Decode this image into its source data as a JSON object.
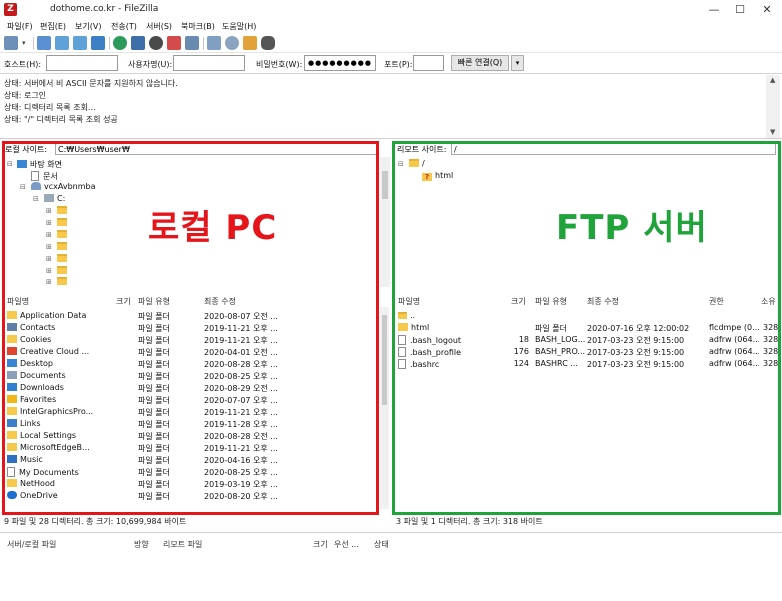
{
  "window": {
    "title": "dothome.co.kr - FileZilla",
    "app_icon_glyph": "Z",
    "minimize": "—",
    "maximize": "☐",
    "close": "✕"
  },
  "menu": [
    "파일(F)",
    "편집(E)",
    "보기(V)",
    "전송(T)",
    "서버(S)",
    "북마크(B)",
    "도움말(H)"
  ],
  "quickconnect": {
    "host_label": "호스트(H):",
    "host_value": "",
    "user_label": "사용자명(U):",
    "user_value": "",
    "pass_label": "비밀번호(W):",
    "pass_value": "●●●●●●●●●",
    "port_label": "포트(P):",
    "port_value": "",
    "connect_button": "빠른 연결(Q)",
    "dropdown_glyph": "▾"
  },
  "log": [
    "상태:  서버에서 비 ASCII 문자를 지원하지 않습니다.",
    "상태:  로그인",
    "상태:  디렉터리 목록 조회...",
    "상태:  \"/\" 디렉터리 목록 조회 성공"
  ],
  "local": {
    "site_label": "로컬 사이트:",
    "path": "C:₩Users₩user₩",
    "tree": {
      "desktop": "바탕 화면",
      "documents": "문서",
      "user": "vcxAvbnmba",
      "drive": "C:"
    },
    "columns": [
      "파일명",
      "크기",
      "파일 유형",
      "최종 수정"
    ],
    "files": [
      {
        "name": "Application Data",
        "type": "파일 폴더",
        "modified": "2020-08-07 오전 ..."
      },
      {
        "name": "Contacts",
        "type": "파일 폴더",
        "modified": "2019-11-21 오후 ..."
      },
      {
        "name": "Cookies",
        "type": "파일 폴더",
        "modified": "2019-11-21 오후 ..."
      },
      {
        "name": "Creative Cloud ...",
        "type": "파일 폴더",
        "modified": "2020-04-01 오전 ..."
      },
      {
        "name": "Desktop",
        "type": "파일 폴더",
        "modified": "2020-08-28 오후 ..."
      },
      {
        "name": "Documents",
        "type": "파일 폴더",
        "modified": "2020-08-25 오후 ..."
      },
      {
        "name": "Downloads",
        "type": "파일 폴더",
        "modified": "2020-08-29 오전 ..."
      },
      {
        "name": "Favorites",
        "type": "파일 폴더",
        "modified": "2020-07-07 오후 ..."
      },
      {
        "name": "IntelGraphicsPro...",
        "type": "파일 폴더",
        "modified": "2019-11-21 오후 ..."
      },
      {
        "name": "Links",
        "type": "파일 폴더",
        "modified": "2019-11-28 오후 ..."
      },
      {
        "name": "Local Settings",
        "type": "파일 폴더",
        "modified": "2020-08-28 오전 ..."
      },
      {
        "name": "MicrosoftEdgeB...",
        "type": "파일 폴더",
        "modified": "2019-11-21 오후 ..."
      },
      {
        "name": "Music",
        "type": "파일 폴더",
        "modified": "2020-04-16 오후 ..."
      },
      {
        "name": "My Documents",
        "type": "파일 폴더",
        "modified": "2020-08-25 오후 ..."
      },
      {
        "name": "NetHood",
        "type": "파일 폴더",
        "modified": "2019-03-19 오후 ..."
      },
      {
        "name": "OneDrive",
        "type": "파일 폴더",
        "modified": "2020-08-20 오후 ..."
      }
    ],
    "status": "9 파일 및 28 디렉터리. 총 크기: 10,699,984 바이트",
    "overlay_label": "로컬 PC",
    "overlay_color": "#e5161b"
  },
  "remote": {
    "site_label": "리모트 사이트:",
    "path": "/",
    "tree": {
      "root": "/",
      "child": "html",
      "unknown_glyph": "?"
    },
    "columns": [
      "파일명",
      "크기",
      "파일 유형",
      "최종 수정",
      "권한",
      "소유"
    ],
    "parent_entry": "..",
    "files": [
      {
        "name": "html",
        "size": "",
        "type": "파일 폴더",
        "modified": "2020-07-16 오후 12:00:02",
        "perm": "flcdmpe (0...",
        "owner": "328"
      },
      {
        "name": ".bash_logout",
        "size": "18",
        "type": "BASH_LOG...",
        "modified": "2017-03-23 오전 9:15:00",
        "perm": "adfrw (064...",
        "owner": "328"
      },
      {
        "name": ".bash_profile",
        "size": "176",
        "type": "BASH_PRO...",
        "modified": "2017-03-23 오전 9:15:00",
        "perm": "adfrw (064...",
        "owner": "328"
      },
      {
        "name": ".bashrc",
        "size": "124",
        "type": "BASHRC ...",
        "modified": "2017-03-23 오전 9:15:00",
        "perm": "adfrw (064...",
        "owner": "328"
      }
    ],
    "status": "3 파일 및 1 디렉터리. 총 크기: 318 바이트",
    "overlay_label": "FTP 서버",
    "overlay_color": "#1fa33a"
  },
  "queue": {
    "columns": [
      "서버/로컬 파일",
      "방향",
      "리모트 파일",
      "크기",
      "우선 ...",
      "상태"
    ]
  }
}
